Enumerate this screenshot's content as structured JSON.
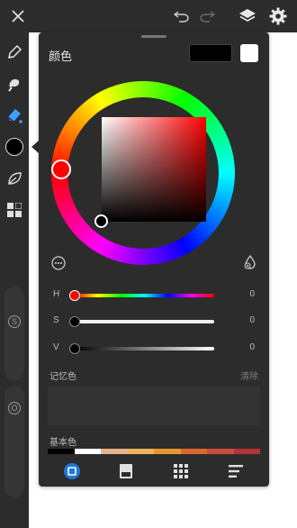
{
  "panel": {
    "title": "颜色",
    "sliders": [
      {
        "label": "H",
        "value": "0"
      },
      {
        "label": "S",
        "value": "0"
      },
      {
        "label": "V",
        "value": "0"
      }
    ],
    "memory_label": "记忆色",
    "clear_label": "清除",
    "basic_label": "基本色",
    "basic_colors": [
      "#000000",
      "#ffffff",
      "#e9b38a",
      "#f0b35a",
      "#e7962e",
      "#d9692f",
      "#cc4a3a",
      "#b13535"
    ],
    "current_color": "#000000",
    "preview_color": "#ffffff"
  },
  "sidebar": {
    "slider_knobs": [
      "S",
      "O"
    ]
  },
  "tabs": [
    "wheel",
    "swatches",
    "grid",
    "sliders"
  ]
}
